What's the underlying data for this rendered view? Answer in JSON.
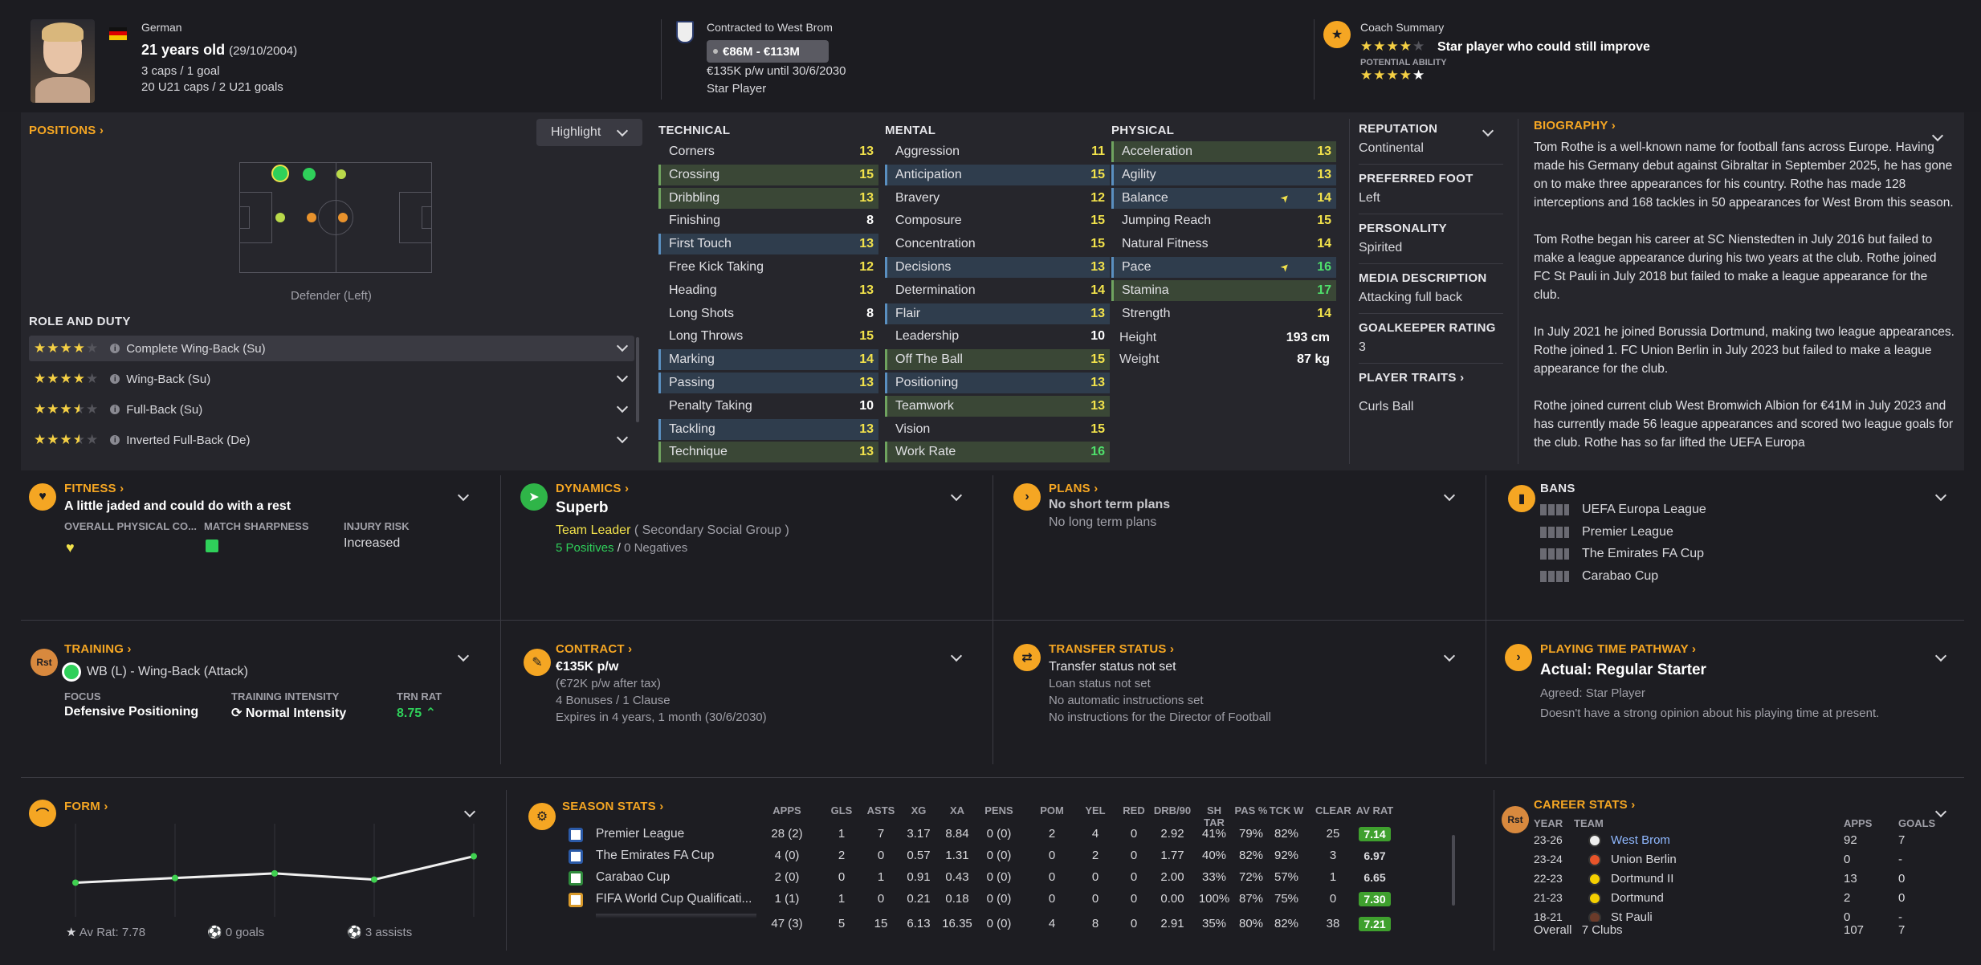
{
  "header": {
    "nationality": "German",
    "age": "21 years old",
    "dob": "(29/10/2004)",
    "caps": "3 caps / 1 goal",
    "u21": "20 U21 caps / 2 U21 goals",
    "contract_title": "Contracted to West Brom",
    "value_range": "€86M - €113M",
    "wage": "€135K p/w until 30/6/2030",
    "status": "Star Player",
    "coach_title": "Coach Summary",
    "coach_summary": "Star player who could still improve",
    "potential_label": "POTENTIAL ABILITY"
  },
  "positions": {
    "title": "POSITIONS",
    "highlight_label": "Highlight",
    "caption": "Defender (Left)",
    "role_title": "ROLE AND DUTY",
    "roles": [
      {
        "name": "Complete Wing-Back (Su)",
        "stars": 4
      },
      {
        "name": "Wing-Back (Su)",
        "stars": 4
      },
      {
        "name": "Full-Back (Su)",
        "stars": 3.5
      },
      {
        "name": "Inverted Full-Back (De)",
        "stars": 3.5
      }
    ]
  },
  "attributes": {
    "technical_title": "TECHNICAL",
    "mental_title": "MENTAL",
    "physical_title": "PHYSICAL",
    "technical": [
      {
        "n": "Corners",
        "v": "13",
        "h": "",
        "c": "yel"
      },
      {
        "n": "Crossing",
        "v": "15",
        "h": "green",
        "c": "yel"
      },
      {
        "n": "Dribbling",
        "v": "13",
        "h": "green",
        "c": "yel"
      },
      {
        "n": "Finishing",
        "v": "8",
        "h": "",
        "c": "wht"
      },
      {
        "n": "First Touch",
        "v": "13",
        "h": "blue",
        "c": "yel"
      },
      {
        "n": "Free Kick Taking",
        "v": "12",
        "h": "",
        "c": "yel"
      },
      {
        "n": "Heading",
        "v": "13",
        "h": "",
        "c": "yel"
      },
      {
        "n": "Long Shots",
        "v": "8",
        "h": "",
        "c": "wht"
      },
      {
        "n": "Long Throws",
        "v": "15",
        "h": "",
        "c": "yel"
      },
      {
        "n": "Marking",
        "v": "14",
        "h": "blue",
        "c": "yel"
      },
      {
        "n": "Passing",
        "v": "13",
        "h": "blue",
        "c": "yel"
      },
      {
        "n": "Penalty Taking",
        "v": "10",
        "h": "",
        "c": "wht"
      },
      {
        "n": "Tackling",
        "v": "13",
        "h": "blue",
        "c": "yel"
      },
      {
        "n": "Technique",
        "v": "13",
        "h": "green",
        "c": "yel"
      }
    ],
    "mental": [
      {
        "n": "Aggression",
        "v": "11",
        "h": "",
        "c": "yel"
      },
      {
        "n": "Anticipation",
        "v": "15",
        "h": "blue",
        "c": "yel"
      },
      {
        "n": "Bravery",
        "v": "12",
        "h": "",
        "c": "yel"
      },
      {
        "n": "Composure",
        "v": "15",
        "h": "",
        "c": "yel"
      },
      {
        "n": "Concentration",
        "v": "15",
        "h": "",
        "c": "yel"
      },
      {
        "n": "Decisions",
        "v": "13",
        "h": "blue",
        "c": "yel"
      },
      {
        "n": "Determination",
        "v": "14",
        "h": "",
        "c": "yel"
      },
      {
        "n": "Flair",
        "v": "13",
        "h": "blue",
        "c": "yel"
      },
      {
        "n": "Leadership",
        "v": "10",
        "h": "",
        "c": "wht"
      },
      {
        "n": "Off The Ball",
        "v": "15",
        "h": "green",
        "c": "yel"
      },
      {
        "n": "Positioning",
        "v": "13",
        "h": "blue",
        "c": "yel"
      },
      {
        "n": "Teamwork",
        "v": "13",
        "h": "green",
        "c": "yel"
      },
      {
        "n": "Vision",
        "v": "15",
        "h": "",
        "c": "yel"
      },
      {
        "n": "Work Rate",
        "v": "16",
        "h": "green",
        "c": "grn"
      }
    ],
    "physical": [
      {
        "n": "Acceleration",
        "v": "13",
        "h": "green",
        "c": "yel",
        "arrow": false
      },
      {
        "n": "Agility",
        "v": "13",
        "h": "blue",
        "c": "yel",
        "arrow": false
      },
      {
        "n": "Balance",
        "v": "14",
        "h": "blue",
        "c": "yel",
        "arrow": true
      },
      {
        "n": "Jumping Reach",
        "v": "15",
        "h": "",
        "c": "yel",
        "arrow": false
      },
      {
        "n": "Natural Fitness",
        "v": "14",
        "h": "",
        "c": "yel",
        "arrow": false
      },
      {
        "n": "Pace",
        "v": "16",
        "h": "blue",
        "c": "grn",
        "arrow": true
      },
      {
        "n": "Stamina",
        "v": "17",
        "h": "green",
        "c": "grn",
        "arrow": false
      },
      {
        "n": "Strength",
        "v": "14",
        "h": "",
        "c": "yel",
        "arrow": false
      }
    ],
    "height_label": "Height",
    "height": "193 cm",
    "weight_label": "Weight",
    "weight": "87 kg"
  },
  "info": {
    "reputation_label": "REPUTATION",
    "reputation": "Continental",
    "foot_label": "PREFERRED FOOT",
    "foot": "Left",
    "personality_label": "PERSONALITY",
    "personality": "Spirited",
    "media_label": "MEDIA DESCRIPTION",
    "media": "Attacking full back",
    "gk_label": "GOALKEEPER RATING",
    "gk": "3",
    "traits_label": "PLAYER TRAITS",
    "trait": "Curls Ball"
  },
  "biography": {
    "title": "BIOGRAPHY",
    "p1": "Tom Rothe is a well-known name for football fans across Europe. Having made his Germany debut against Gibraltar in September 2025, he has gone on to make three appearances for his country. Rothe has made 128 interceptions and 168 tackles in 50 appearances for West Brom this season.",
    "p2": "Tom Rothe began his career at SC Nienstedten in July 2016 but failed to make a league appearance during his two years at the club. Rothe joined FC St Pauli in July 2018 but failed to make a league appearance for the club.",
    "p3": "In July 2021 he joined Borussia Dortmund, making two league appearances. Rothe joined 1. FC Union Berlin in July 2023 but failed to make a league appearance for the club.",
    "p4": "Rothe joined current club West Bromwich Albion for €41M in July 2023 and has currently made 56 league appearances and scored two league goals for the club. Rothe has so far lifted the UEFA Europa"
  },
  "fitness": {
    "title": "FITNESS",
    "status": "A little jaded and could do with a rest",
    "col1": "OVERALL PHYSICAL CO...",
    "col2": "MATCH SHARPNESS",
    "col3": "INJURY RISK",
    "injury": "Increased"
  },
  "dynamics": {
    "title": "DYNAMICS",
    "status": "Superb",
    "role": "Team Leader",
    "group": "( Secondary Social Group )",
    "positives": "5 Positives",
    "sep": "/",
    "negatives": "0 Negatives"
  },
  "plans": {
    "title": "PLANS",
    "line1": "No short term plans",
    "line2": "No long term plans"
  },
  "bans": {
    "title": "BANS",
    "items": [
      "UEFA Europa League",
      "Premier League",
      "The Emirates FA Cup",
      "Carabao Cup"
    ]
  },
  "training": {
    "title": "TRAINING",
    "icon_text": "Rst",
    "role": "WB (L) - Wing-Back (Attack)",
    "focus_label": "FOCUS",
    "focus": "Defensive Positioning",
    "intensity_label": "TRAINING INTENSITY",
    "intensity": "Normal Intensity",
    "rat_label": "TRN RAT",
    "rat": "8.75"
  },
  "contract": {
    "title": "CONTRACT",
    "wage": "€135K p/w",
    "after_tax": "(€72K p/w after tax)",
    "bonuses": "4 Bonuses / 1 Clause",
    "expires": "Expires in 4 years, 1 month (30/6/2030)"
  },
  "transfer": {
    "title": "TRANSFER STATUS",
    "l1": "Transfer status not set",
    "l2": "Loan status not set",
    "l3": "No automatic instructions set",
    "l4": "No instructions for the Director of Football"
  },
  "pathway": {
    "title": "PLAYING TIME PATHWAY",
    "actual": "Actual: Regular Starter",
    "agreed": "Agreed: Star Player",
    "note": "Doesn't have a strong opinion about his playing time at present."
  },
  "form": {
    "title": "FORM",
    "av_rat": "Av Rat: 7.78",
    "goals": "0 goals",
    "assists": "3 assists"
  },
  "chart_data": {
    "type": "line",
    "values": [
      7.1,
      7.25,
      7.4,
      7.2,
      7.95
    ],
    "ylim": [
      6,
      9
    ]
  },
  "season": {
    "title": "SEASON STATS",
    "headers": [
      "APPS",
      "GLS",
      "ASTS",
      "XG",
      "XA",
      "PENS",
      "POM",
      "YEL",
      "RED",
      "DRB/90",
      "SH TAR",
      "PAS %",
      "TCK W",
      "CLEAR",
      "AV RAT"
    ],
    "rows": [
      {
        "comp": "Premier League",
        "cells": [
          "28 (2)",
          "1",
          "7",
          "3.17",
          "8.84",
          "0 (0)",
          "2",
          "4",
          "0",
          "2.92",
          "41%",
          "79%",
          "82%",
          "25"
        ],
        "rat": "7.14",
        "green": true
      },
      {
        "comp": "The Emirates FA Cup",
        "cells": [
          "4 (0)",
          "2",
          "0",
          "0.57",
          "1.31",
          "0 (0)",
          "0",
          "2",
          "0",
          "1.77",
          "40%",
          "82%",
          "92%",
          "3"
        ],
        "rat": "6.97",
        "green": false
      },
      {
        "comp": "Carabao Cup",
        "cells": [
          "2 (0)",
          "0",
          "1",
          "0.91",
          "0.43",
          "0 (0)",
          "0",
          "0",
          "0",
          "2.00",
          "33%",
          "72%",
          "57%",
          "1"
        ],
        "rat": "6.65",
        "green": false
      },
      {
        "comp": "FIFA World Cup Qualificati...",
        "cells": [
          "1 (1)",
          "1",
          "0",
          "0.21",
          "0.18",
          "0 (0)",
          "0",
          "0",
          "0",
          "0.00",
          "100%",
          "87%",
          "75%",
          "0"
        ],
        "rat": "7.30",
        "green": true
      }
    ],
    "totals": [
      "47 (3)",
      "5",
      "15",
      "6.13",
      "16.35",
      "0 (0)",
      "4",
      "8",
      "0",
      "2.91",
      "35%",
      "80%",
      "82%",
      "38"
    ],
    "total_rat": "7.21"
  },
  "career": {
    "title": "CAREER STATS",
    "icon_text": "Rst",
    "h_year": "YEAR",
    "h_team": "TEAM",
    "h_apps": "APPS",
    "h_goals": "GOALS",
    "rows": [
      {
        "year": "23-26",
        "team": "West Brom",
        "apps": "92",
        "goals": "7",
        "link": true
      },
      {
        "year": "23-24",
        "team": "Union Berlin",
        "apps": "0",
        "goals": "-",
        "link": false
      },
      {
        "year": "22-23",
        "team": "Dortmund II",
        "apps": "13",
        "goals": "0",
        "link": false
      },
      {
        "year": "21-23",
        "team": "Dortmund",
        "apps": "2",
        "goals": "0",
        "link": false
      },
      {
        "year": "18-21",
        "team": "St Pauli",
        "apps": "0",
        "goals": "-",
        "link": false
      }
    ],
    "overall": "Overall",
    "clubs": "7 Clubs",
    "total_apps": "107",
    "total_goals": "7"
  }
}
